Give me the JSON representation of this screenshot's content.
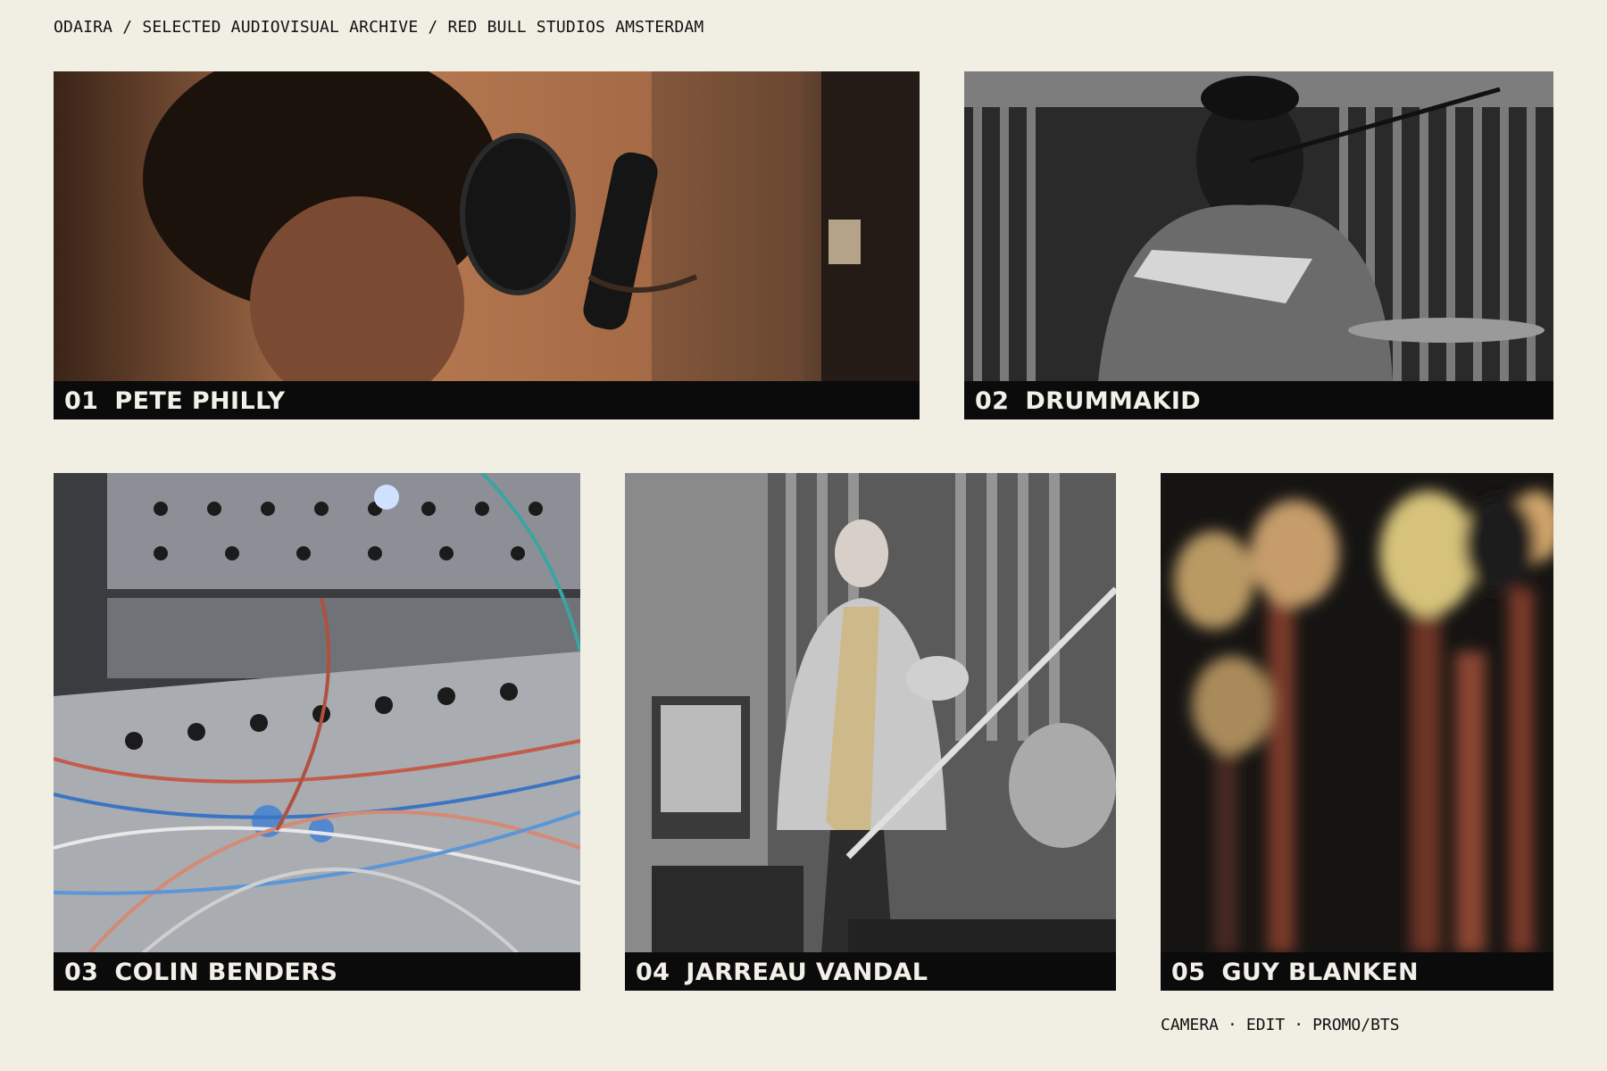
{
  "header": {
    "breadcrumb": "ODAIRA / SELECTED AUDIOVISUAL ARCHIVE / RED BULL STUDIOS AMSTERDAM"
  },
  "tiles": [
    {
      "num": "01",
      "name": "PETE PHILLY"
    },
    {
      "num": "02",
      "name": "DRUMMAKID"
    },
    {
      "num": "03",
      "name": "COLIN BENDERS"
    },
    {
      "num": "04",
      "name": "JARREAU VANDAL"
    },
    {
      "num": "05",
      "name": "GUY BLANKEN"
    }
  ],
  "footer": {
    "items": [
      "CAMERA",
      "EDIT",
      "PROMO/BTS"
    ],
    "separator": "·"
  },
  "colors": {
    "background": "#f1eee3",
    "caption_bar": "#0b0b0b",
    "caption_text": "#f2f0e8"
  }
}
